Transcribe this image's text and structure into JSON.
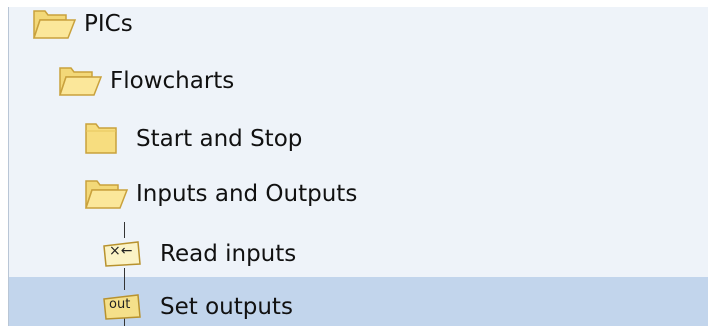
{
  "tree": {
    "nodes": [
      {
        "label": "PICs",
        "icon": "folder-open-icon"
      },
      {
        "label": "Flowcharts",
        "icon": "folder-open-icon"
      },
      {
        "label": "Start and Stop",
        "icon": "folder-closed-icon"
      },
      {
        "label": "Inputs and Outputs",
        "icon": "folder-open-icon"
      },
      {
        "label": "Read inputs",
        "icon": "read-inputs-icon",
        "icon_text": "×←"
      },
      {
        "label": "Set outputs",
        "icon": "set-outputs-icon",
        "icon_text": "out",
        "selected": true
      }
    ]
  },
  "colors": {
    "panel_background": "#eef3f9",
    "selection": "#c2d5ec",
    "folder_fill": "#f7dd7f",
    "folder_outline": "#c9a13c"
  }
}
